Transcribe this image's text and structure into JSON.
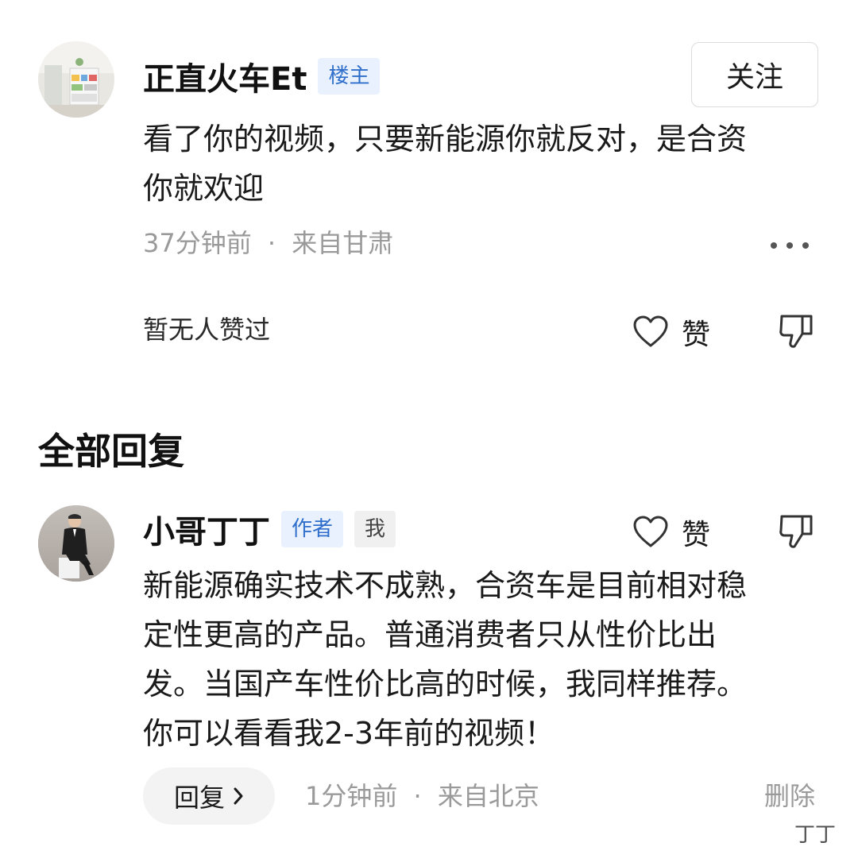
{
  "post": {
    "author_name": "正直火车Et",
    "author_badge": "楼主",
    "follow_label": "关注",
    "content_line1": "看了你的视频，只要新能源你就反对，是合资",
    "content_line2": "你就欢迎",
    "time": "37分钟前",
    "separator": "·",
    "location": "来自甘肃",
    "more_icon": "more-dots-icon",
    "likes_status": "暂无人赞过",
    "like_label": "赞",
    "like_icon": "heart-outline-icon",
    "dislike_icon": "thumbs-down-icon"
  },
  "replies_section": {
    "title": "全部回复"
  },
  "reply": {
    "author_name": "小哥丁丁",
    "author_badge": "作者",
    "self_badge": "我",
    "like_label": "赞",
    "content_line1": "新能源确实技术不成熟，合资车是目前相对稳",
    "content_line2": "定性更高的产品。普通消费者只从性价比出",
    "content_line3": "发。当国产车性价比高的时候，我同样推荐。",
    "content_line4": "你可以看看我2-3年前的视频！",
    "reply_button_label": "回复",
    "time": "1分钟前",
    "separator": "·",
    "location": "来自北京",
    "delete_label": "删除"
  },
  "watermark": {
    "text": "丁丁"
  },
  "colors": {
    "badge_blue_bg": "#e8f1fd",
    "badge_blue_text": "#2f6fcb",
    "meta_gray": "#9a9a9a",
    "text_dark": "#1a1a1a"
  }
}
